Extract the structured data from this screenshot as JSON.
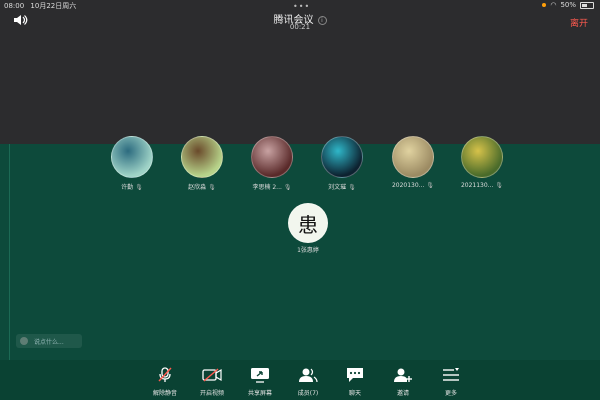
{
  "status": {
    "time": "08:00",
    "date": "10月22日周六",
    "battery": "50%"
  },
  "header": {
    "title": "腾讯会议",
    "timer": "00:21",
    "leave_label": "离开"
  },
  "participants": [
    {
      "name": "许勤",
      "colors": [
        "#9fd3c7",
        "#2c6b7f"
      ]
    },
    {
      "name": "赵欣淼",
      "colors": [
        "#b7d38a",
        "#6a4a2b"
      ]
    },
    {
      "name": "李思楠 2...",
      "colors": [
        "#5a2a2a",
        "#c8a2a2"
      ]
    },
    {
      "name": "刘文璀",
      "colors": [
        "#0d2230",
        "#2fb7c9"
      ]
    },
    {
      "name": "2020130...",
      "colors": [
        "#9c8b63",
        "#e0d2a0"
      ]
    },
    {
      "name": "2021130...",
      "colors": [
        "#4a6b2a",
        "#d6c24a"
      ]
    }
  ],
  "active_user": {
    "name": "1张惠婷",
    "avatar_char": "患"
  },
  "chat": {
    "placeholder": "说点什么..."
  },
  "toolbar": [
    {
      "label": "解除静音",
      "icon": "mic-muted-icon"
    },
    {
      "label": "开启视频",
      "icon": "camera-off-icon"
    },
    {
      "label": "共享屏幕",
      "icon": "share-screen-icon"
    },
    {
      "label": "成员(7)",
      "icon": "members-icon"
    },
    {
      "label": "聊天",
      "icon": "chat-icon"
    },
    {
      "label": "邀请",
      "icon": "invite-icon"
    },
    {
      "label": "更多",
      "icon": "more-icon"
    }
  ]
}
